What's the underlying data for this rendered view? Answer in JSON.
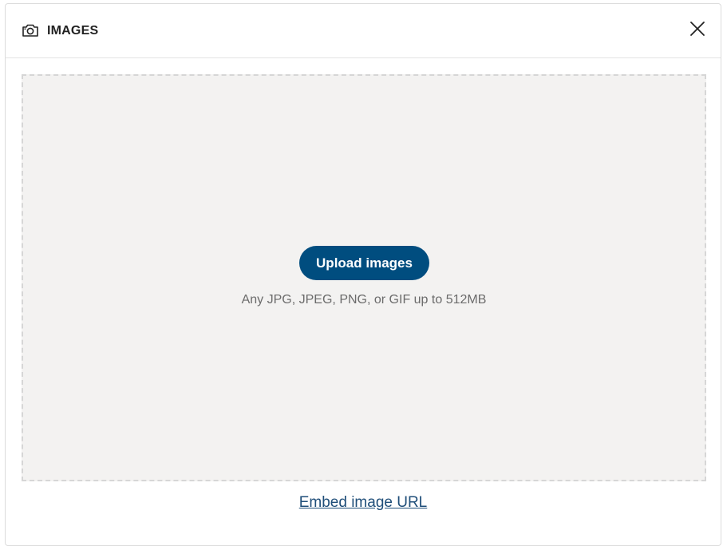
{
  "dialog": {
    "title": "IMAGES",
    "title_icon": "camera-icon",
    "close_icon": "close-icon"
  },
  "dropzone": {
    "upload_button_label": "Upload images",
    "hint": "Any JPG, JPEG, PNG, or GIF up to 512MB"
  },
  "footer": {
    "embed_link_label": "Embed image URL"
  },
  "colors": {
    "primary": "#004d7f",
    "link": "#1f4e79",
    "dropzone_bg": "#f3f2f1",
    "hint_text": "#6b6b6b"
  }
}
